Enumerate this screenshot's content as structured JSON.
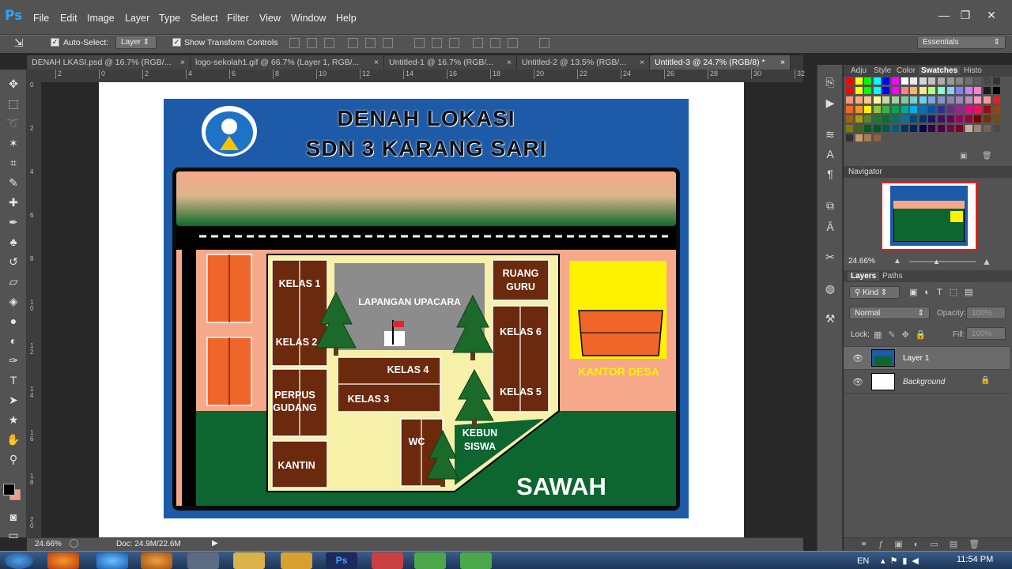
{
  "app": {
    "logo": "Ps"
  },
  "menu": [
    "File",
    "Edit",
    "Image",
    "Layer",
    "Type",
    "Select",
    "Filter",
    "View",
    "Window",
    "Help"
  ],
  "window_controls": {
    "minimize": "—",
    "restore": "❐",
    "close": "✕"
  },
  "options": {
    "move_icon": "move-tool-icon",
    "auto_select_label": "Auto-Select:",
    "auto_select_value": "Layer",
    "show_transform_label": "Show Transform Controls",
    "workspace": "Essentials"
  },
  "tabs": [
    {
      "label": "DENAH LKASI.psd @ 16.7% (RGB/...",
      "close": "×"
    },
    {
      "label": "logo-sekolah1.gif @ 66.7% (Layer 1, RGB/...",
      "close": "×"
    },
    {
      "label": "Untitled-1 @ 16.7% (RGB/...",
      "close": "×"
    },
    {
      "label": "Untitled-2 @ 13.5% (RGB/...",
      "close": "×"
    },
    {
      "label": "Untitled-3 @ 24.7% (RGB/8) *",
      "close": "×"
    }
  ],
  "ruler": {
    "h": [
      "2",
      "0",
      "2",
      "4",
      "6",
      "8",
      "10",
      "12",
      "14",
      "16",
      "18",
      "20",
      "22",
      "24",
      "26",
      "28",
      "30",
      "32"
    ],
    "v": [
      "0",
      "2",
      "4",
      "6",
      "8",
      "1\n0",
      "1\n2",
      "1\n4",
      "1\n6",
      "1\n8",
      "2\n0"
    ]
  },
  "status": {
    "zoom": "24.66%",
    "doc": "Doc: 24.9M/22.6M"
  },
  "map": {
    "title1": "DENAH LOKASI",
    "title2": "SDN 3 KARANG SARI",
    "kelas1": "KELAS 1",
    "kelas2": "KELAS 2",
    "kelas3": "KELAS 3",
    "kelas4": "KELAS 4",
    "kelas5": "KELAS 5",
    "kelas6": "KELAS 6",
    "ruang_guru": [
      "RUANG",
      "GURU"
    ],
    "perpus": [
      "PERPUS",
      "GUDANG"
    ],
    "kantin": "KANTIN",
    "wc": "WC",
    "lapangan": "LAPANGAN UPACARA",
    "kebun": [
      "KEBUN",
      "SISWA"
    ],
    "kantor_desa": "KANTOR DESA",
    "sawah": "SAWAH"
  },
  "panels": {
    "swatch_tabs": [
      "Adju",
      "Style",
      "Color",
      "Swatches",
      "Histo"
    ],
    "navigator": "Navigator",
    "nav_zoom": "24.66%",
    "layer_tabs": [
      "Layers",
      "Paths"
    ],
    "kind": "Kind",
    "blend": "Normal",
    "opacity_label": "Opacity:",
    "opacity_value": "100%",
    "lock_label": "Lock:",
    "fill_label": "Fill:",
    "fill_value": "100%",
    "layers": [
      {
        "name": "Layer 1"
      },
      {
        "name": "Background"
      }
    ]
  },
  "taskbar": {
    "lang": "EN",
    "time": "11:54 PM"
  },
  "colors": {
    "accent": "#2fa4ff",
    "map_blue": "#1d5aa8",
    "brown": "#6b2a0e",
    "orange": "#f0652a",
    "green": "#0d6530"
  }
}
